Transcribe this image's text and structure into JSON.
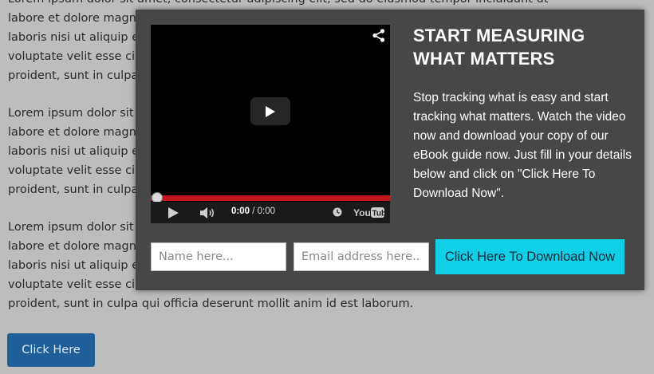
{
  "background": {
    "paragraphs": [
      [
        "Lorem ipsum dolor sit amet, consectetur adipiscing elit, sed do eiusmod tempor incididunt ut",
        "labore et dolore magna a",
        "laboris nisi ut aliquip ex c",
        "voluptate velit esse cillum",
        "proident, sunt in culpa q"
      ],
      [
        "Lorem ipsum dolor sit am",
        "labore et dolore magna a",
        "laboris nisi ut aliquip ex c",
        "voluptate velit esse cillum",
        "proident, sunt in culpa q"
      ],
      [
        "Lorem ipsum dolor sit am",
        "labore et dolore magna a",
        "laboris nisi ut aliquip ex c",
        "voluptate velit esse cillum",
        "proident, sunt in culpa qui officia deserunt mollit anim id est laborum."
      ]
    ],
    "button_label": "Click Here"
  },
  "modal": {
    "video": {
      "current_time": "0:00",
      "separator": " / ",
      "duration": "0:00",
      "progress": 0,
      "icons": [
        "share-icon",
        "play-icon",
        "volume-icon",
        "clock-icon",
        "youtube-logo"
      ]
    },
    "headline": "START MEASURING WHAT MATTERS",
    "description": "Stop tracking what is easy and start tracking what matters. Watch the video now and download your copy of our eBook guide now. Just fill in your details below and click on \"Click Here To Download Now\".",
    "form": {
      "name_placeholder": "Name here...",
      "name_value": "",
      "email_placeholder": "Email address here...",
      "email_value": "",
      "submit_label": "Click Here To Download Now"
    }
  },
  "colors": {
    "overlay_background": "#bdbdbd",
    "modal_background": "#474747",
    "cta_accent": "#10cfe6",
    "progress_red": "#c3151d",
    "page_button": "#1f5f99"
  }
}
